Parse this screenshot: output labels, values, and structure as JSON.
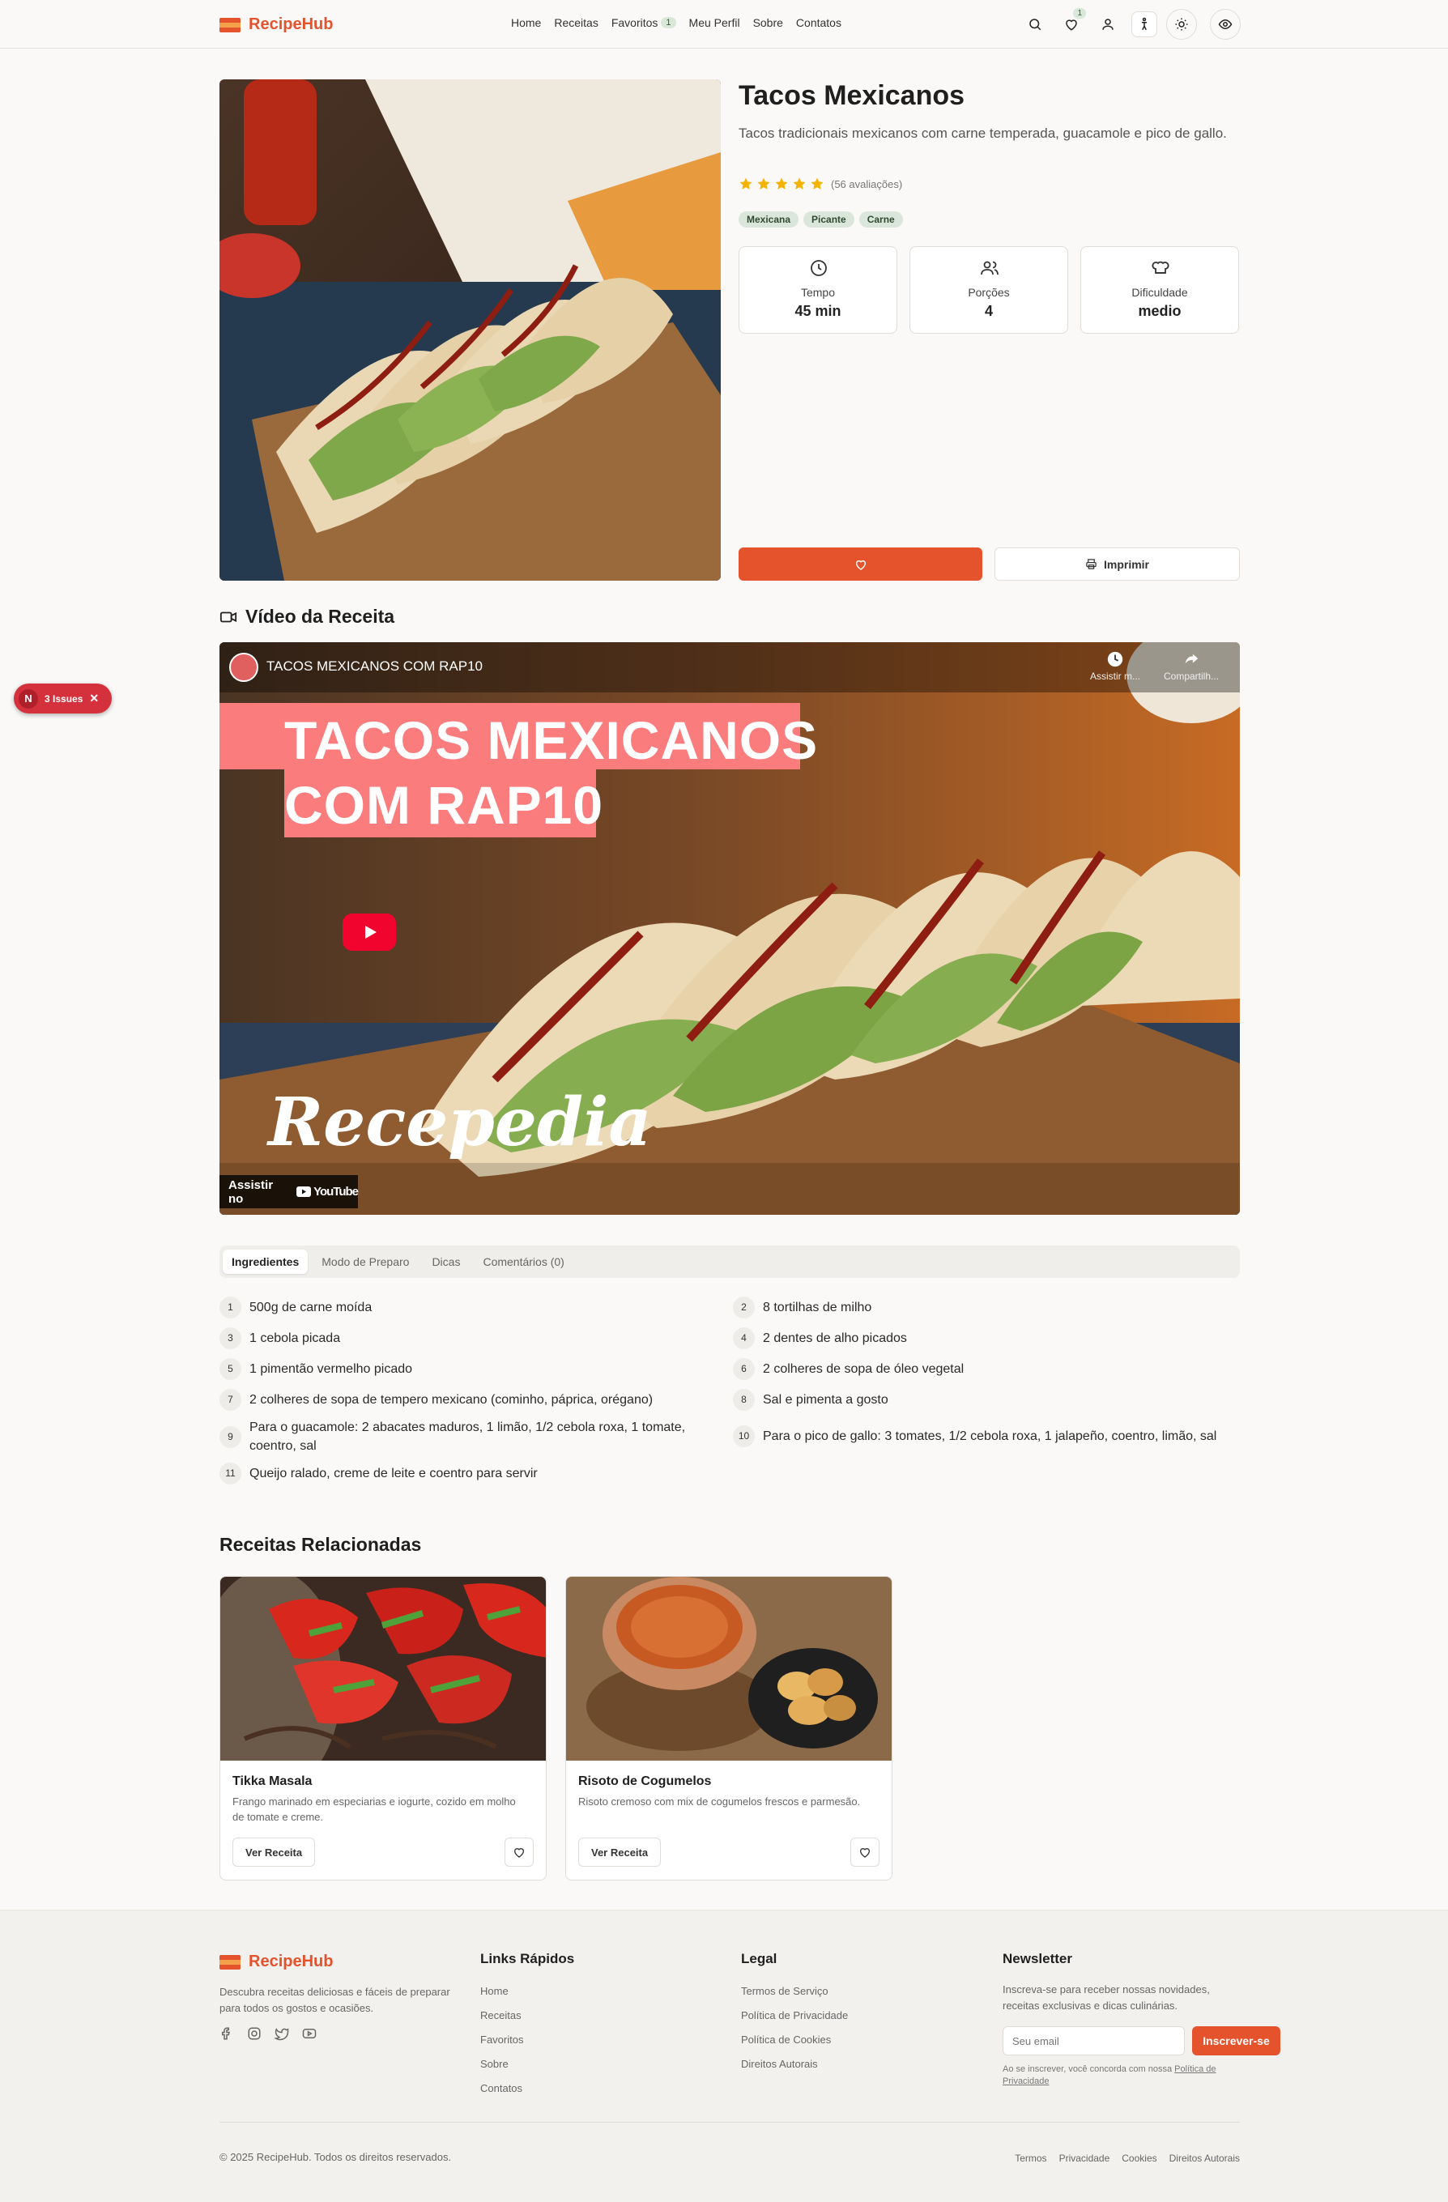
{
  "header": {
    "brand": "RecipeHub",
    "nav": [
      {
        "label": "Home"
      },
      {
        "label": "Receitas"
      },
      {
        "label": "Favoritos",
        "badge": "1"
      },
      {
        "label": "Meu Perfil"
      },
      {
        "label": "Sobre"
      },
      {
        "label": "Contatos"
      }
    ],
    "favorites_count": "1",
    "icons": [
      "search-icon",
      "heart-icon",
      "user-icon",
      "accessibility-icon",
      "sun-icon",
      "eye-icon"
    ]
  },
  "recipe": {
    "title": "Tacos Mexicanos",
    "description": "Tacos tradicionais mexicanos com carne temperada, guacamole e pico de gallo.",
    "rating": 5,
    "reviews": "(56 avaliações)",
    "tags": [
      "Mexicana",
      "Picante",
      "Carne"
    ],
    "stats": [
      {
        "label": "Tempo",
        "value": "45 min",
        "icon": "clock-icon"
      },
      {
        "label": "Porções",
        "value": "4",
        "icon": "users-icon"
      },
      {
        "label": "Dificuldade",
        "value": "medio",
        "icon": "chef-hat-icon"
      }
    ],
    "print_label": "Imprimir"
  },
  "video": {
    "section_title": "Vídeo da Receita",
    "channel_title": "TACOS MEXICANOS COM RAP10",
    "watch_later": "Assistir m...",
    "share": "Compartilh...",
    "overlay_line1": "TACOS MEXICANOS",
    "overlay_line2": "COM RAP10",
    "brand_overlay": "Recepedia",
    "watch_on": "Assistir no",
    "youtube": "YouTube"
  },
  "tabs": [
    "Ingredientes",
    "Modo de Preparo",
    "Dicas",
    "Comentários (0)"
  ],
  "ingredients": [
    {
      "n": "1",
      "text": "500g de carne moída"
    },
    {
      "n": "2",
      "text": "8 tortilhas de milho"
    },
    {
      "n": "3",
      "text": "1 cebola picada"
    },
    {
      "n": "4",
      "text": "2 dentes de alho picados"
    },
    {
      "n": "5",
      "text": "1 pimentão vermelho picado"
    },
    {
      "n": "6",
      "text": "2 colheres de sopa de óleo vegetal"
    },
    {
      "n": "7",
      "text": "2 colheres de sopa de tempero mexicano (cominho, páprica, orégano)"
    },
    {
      "n": "8",
      "text": "Sal e pimenta a gosto"
    },
    {
      "n": "9",
      "text": "Para o guacamole: 2 abacates maduros, 1 limão, 1/2 cebola roxa, 1 tomate, coentro, sal"
    },
    {
      "n": "10",
      "text": "Para o pico de gallo: 3 tomates, 1/2 cebola roxa, 1 jalapeño, coentro, limão, sal"
    },
    {
      "n": "11",
      "text": "Queijo ralado, creme de leite e coentro para servir"
    }
  ],
  "related": {
    "title": "Receitas Relacionadas",
    "cards": [
      {
        "title": "Tikka Masala",
        "description": "Frango marinado em especiarias e iogurte, cozido em molho de tomate e creme.",
        "button": "Ver Receita"
      },
      {
        "title": "Risoto de Cogumelos",
        "description": "Risoto cremoso com mix de cogumelos frescos e parmesão.",
        "button": "Ver Receita"
      }
    ]
  },
  "footer": {
    "brand": "RecipeHub",
    "about": "Descubra receitas deliciosas e fáceis de preparar para todos os gostos e ocasiões.",
    "quick_links_title": "Links Rápidos",
    "quick_links": [
      "Home",
      "Receitas",
      "Favoritos",
      "Sobre",
      "Contatos"
    ],
    "legal_title": "Legal",
    "legal_links": [
      "Termos de Serviço",
      "Política de Privacidade",
      "Política de Cookies",
      "Direitos Autorais"
    ],
    "newsletter_title": "Newsletter",
    "newsletter_text": "Inscreva-se para receber nossas novidades, receitas exclusivas e dicas culinárias.",
    "email_placeholder": "Seu email",
    "subscribe": "Inscrever-se",
    "consent": "Ao se inscrever, você concorda com nossa",
    "consent_link": "Política de Privacidade",
    "copyright": "© 2025 RecipeHub. Todos os direitos reservados.",
    "bottom_links": [
      "Termos",
      "Privacidade",
      "Cookies",
      "Direitos Autorais"
    ]
  },
  "issues_badge": {
    "letter": "N",
    "label": "3 Issues"
  },
  "colors": {
    "accent": "#e4532b",
    "tag_bg": "#dbe6db",
    "star": "#f5b301",
    "issues": "#d4313d"
  }
}
